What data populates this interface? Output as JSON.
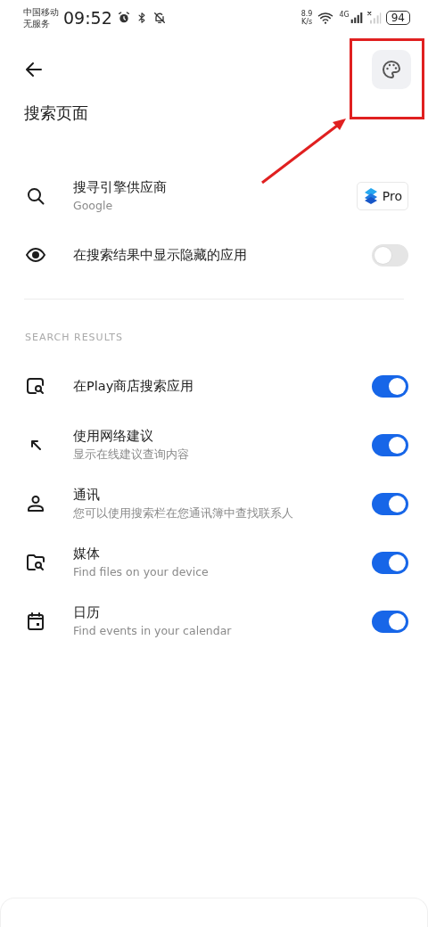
{
  "status_bar": {
    "carrier": "中国移动",
    "service": "无服务",
    "time": "09:52",
    "speed_value": "8.9",
    "speed_unit": "K/s",
    "network": "4G",
    "battery": "94"
  },
  "header": {
    "title": "搜索页面"
  },
  "settings": [
    {
      "title": "搜寻引擎供应商",
      "subtitle": "Google",
      "kind": "pro",
      "badge": "Pro"
    },
    {
      "title": "在搜索结果中显示隐藏的应用",
      "kind": "toggle",
      "on": false
    }
  ],
  "section": {
    "header": "SEARCH RESULTS",
    "rows": [
      {
        "title": "在Play商店搜索应用",
        "kind": "toggle",
        "on": true
      },
      {
        "title": "使用网络建议",
        "subtitle": "显示在线建议查询内容",
        "kind": "toggle",
        "on": true
      },
      {
        "title": "通讯",
        "subtitle": "您可以使用搜索栏在您通讯簿中查找联系人",
        "kind": "toggle",
        "on": true
      },
      {
        "title": "媒体",
        "subtitle": "Find files on your device",
        "kind": "toggle",
        "on": true
      },
      {
        "title": "日历",
        "subtitle": "Find events in your calendar",
        "kind": "toggle",
        "on": true
      }
    ]
  }
}
